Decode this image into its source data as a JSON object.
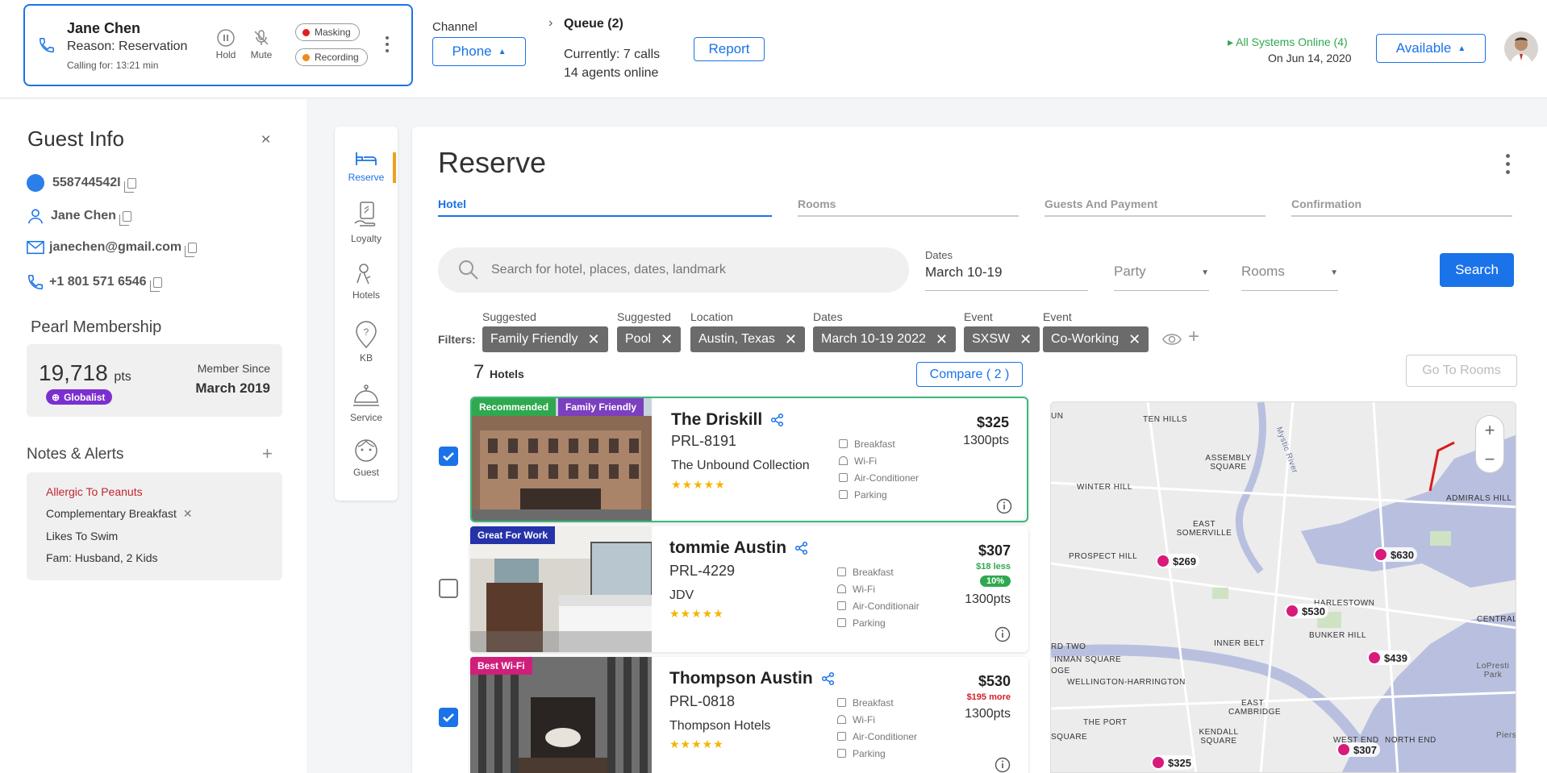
{
  "call": {
    "caller_name": "Jane Chen",
    "reason": "Reason: Reservation",
    "duration": "Calling for: 13:21 min",
    "hold_label": "Hold",
    "mute_label": "Mute",
    "masking_label": "Masking",
    "recording_label": "Recording"
  },
  "channel": {
    "label": "Channel",
    "value": "Phone"
  },
  "queue": {
    "title": "Queue (2)",
    "calls": "Currently: 7 calls",
    "agents": "14 agents online"
  },
  "report_label": "Report",
  "systems": {
    "status": "All Systems Online (4)",
    "date": "On Jun 14, 2020"
  },
  "availability": "Available",
  "guest": {
    "title": "Guest Info",
    "id": "558744542I",
    "name": "Jane Chen",
    "email": "janechen@gmail.com",
    "phone": "+1 801 571 6546"
  },
  "membership": {
    "title": "Pearl Membership",
    "points": "19,718",
    "pts_unit": "pts",
    "tier": "Globalist",
    "since_label": "Member Since",
    "since_value": "March 2019"
  },
  "notes": {
    "title": "Notes & Alerts",
    "items": [
      "Allergic To Peanuts",
      "Complementary Breakfast",
      "Likes To Swim",
      "Fam: Husband, 2 Kids"
    ]
  },
  "nav": {
    "items": [
      "Reserve",
      "Loyalty",
      "Hotels",
      "KB",
      "Service",
      "Guest"
    ]
  },
  "reserve": {
    "title": "Reserve",
    "steps": [
      "Hotel",
      "Rooms",
      "Guests And Payment",
      "Confirmation"
    ],
    "search_placeholder": "Search for hotel, places, dates, landmark",
    "dates_label": "Dates",
    "dates_value": "March 10-19",
    "party_placeholder": "Party",
    "rooms_placeholder": "Rooms",
    "search_button": "Search",
    "filters_label": "Filters:",
    "filters": [
      {
        "category": "Suggested",
        "value": "Family Friendly"
      },
      {
        "category": "Suggested",
        "value": "Pool"
      },
      {
        "category": "Location",
        "value": "Austin, Texas"
      },
      {
        "category": "Dates",
        "value": "March 10-19 2022"
      },
      {
        "category": "Event",
        "value": "SXSW"
      },
      {
        "category": "Event",
        "value": "Co-Working"
      }
    ],
    "count": "7",
    "count_label": "Hotels",
    "compare_label": "Compare ( 2 )",
    "go_rooms_label": "Go To Rooms"
  },
  "hotels": [
    {
      "name": "The Driskill",
      "code": "PRL-8191",
      "brand": "The Unbound Collection",
      "price": "$325",
      "delta": "",
      "discount": "",
      "points": "1300pts",
      "tags": [
        "Recommended",
        "Family Friendly"
      ],
      "amenities": [
        "Breakfast",
        "Wi-Fi",
        "Air-Conditioner",
        "Parking"
      ],
      "stars": "★★★★★",
      "checked": true
    },
    {
      "name": "tommie Austin",
      "code": "PRL-4229",
      "brand": "JDV",
      "price": "$307",
      "delta": "$18 less",
      "discount": "10%",
      "points": "1300pts",
      "tags": [
        "Great For Work"
      ],
      "amenities": [
        "Breakfast",
        "Wi-Fi",
        "Air-Conditionair",
        "Parking"
      ],
      "stars": "★★★★★",
      "checked": false
    },
    {
      "name": "Thompson Austin",
      "code": "PRL-0818",
      "brand": "Thompson Hotels",
      "price": "$530",
      "delta": "$195 more",
      "discount": "",
      "points": "1300pts",
      "tags": [
        "Best Wi-Fi"
      ],
      "amenities": [
        "Breakfast",
        "Wi-Fi",
        "Air-Conditioner",
        "Parking"
      ],
      "stars": "★★★★★",
      "checked": true
    }
  ],
  "map": {
    "labels": [
      "TEN HILLS",
      "ASSEMBLY SQUARE",
      "Mystic River",
      "WINTER HILL",
      "EAST SOMERVILLE",
      "ADMIRALS HILL",
      "PROSPECT HILL",
      "HARLESTOWN",
      "BUNKER HILL",
      "INNER BELT",
      "CENTRAL",
      "RD TWO",
      "INMAN SQUARE",
      "WELLINGTON-HARRINGTON",
      "LoPresti Park",
      "EAST CAMBRIDGE",
      "THE PORT",
      "KENDALL SQUARE",
      "WEST END",
      "NORTH END",
      "SQUARE",
      "UN",
      "OGE",
      "Piers"
    ],
    "pins": [
      "$269",
      "$630",
      "$530",
      "$439",
      "$325",
      "$307"
    ]
  },
  "colors": {
    "accent": "#1a73e8",
    "recommended": "#2fa84f",
    "family": "#7b3fbf",
    "work": "#2633a8",
    "wifi": "#d01f7b",
    "tier": "#7c2fd0"
  }
}
